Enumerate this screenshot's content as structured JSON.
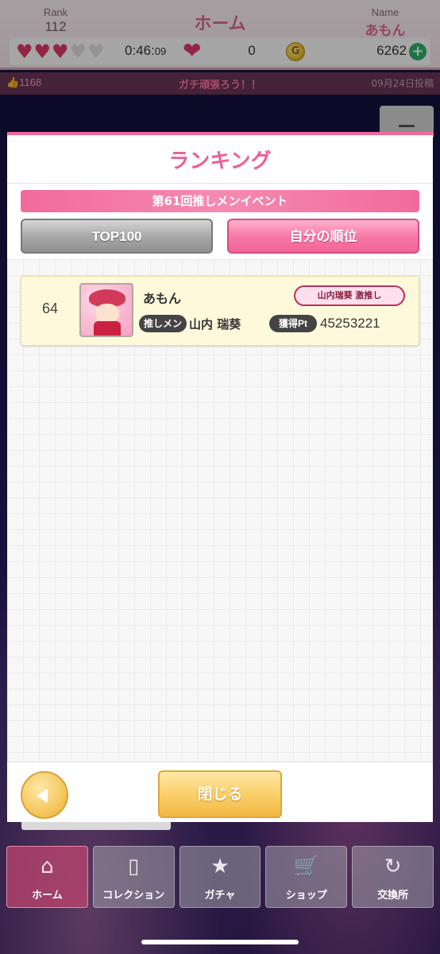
{
  "header": {
    "rank_label": "Rank",
    "rank_value": "112",
    "title": "ホーム",
    "name_label": "Name",
    "name_value": "あもん",
    "hearts_full": 3,
    "hearts_total": 5,
    "timer_main": "0:46:",
    "timer_sec": "09",
    "gem_count": "0",
    "coin_count": "6262",
    "icons": [
      "heart-icon",
      "big-heart-icon",
      "coin-icon",
      "plus-icon"
    ]
  },
  "info_bar": {
    "likes": "👍1168",
    "news": "ガチ頑張ろう！！",
    "date": "09月24日投稿"
  },
  "modal": {
    "title": "ランキング",
    "event_name": "第61回推しメンイベント",
    "tabs": {
      "top100": "TOP100",
      "mine": "自分の順位"
    },
    "rows": [
      {
        "rank": "64",
        "name": "あもん",
        "badge": "山内瑞葵 激推し",
        "oshi_label": "推しメン",
        "oshi_name": "山内 瑞葵",
        "pt_label": "獲得Pt",
        "pt_value": "45253221"
      }
    ],
    "close_label": "閉じる"
  },
  "bottom_nav": {
    "items": [
      {
        "label": "ホーム",
        "icon": "home-icon",
        "glyph": "⌂"
      },
      {
        "label": "コレクション",
        "icon": "collection-icon",
        "glyph": "▯"
      },
      {
        "label": "ガチャ",
        "icon": "gacha-icon",
        "glyph": "★"
      },
      {
        "label": "ショップ",
        "icon": "cart-icon",
        "glyph": "🛒"
      },
      {
        "label": "交換所",
        "icon": "exchange-icon",
        "glyph": "↻"
      }
    ]
  },
  "colors": {
    "accent_pink": "#ec5f96",
    "event_banner": "#f26a9c",
    "row_bg": "#fff9dc",
    "close_button": "#fbd06a"
  }
}
